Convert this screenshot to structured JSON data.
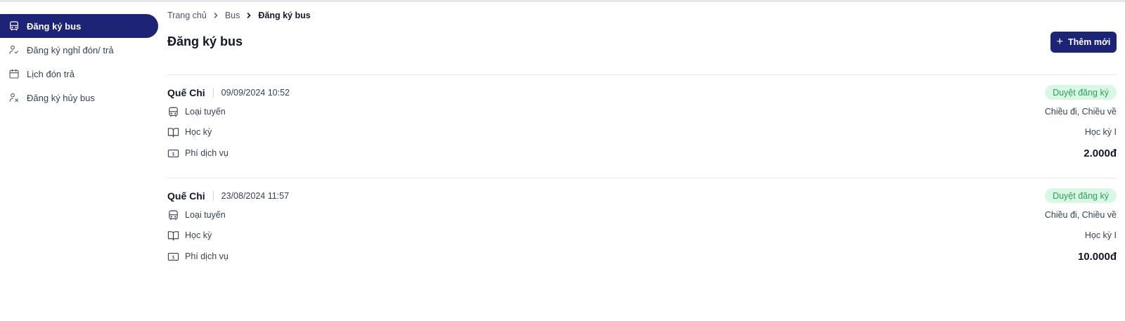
{
  "sidebar": {
    "items": [
      {
        "label": "Đăng ký bus",
        "icon": "bus-icon",
        "active": true
      },
      {
        "label": "Đăng ký nghỉ đón/ trả",
        "icon": "user-check-icon",
        "active": false
      },
      {
        "label": "Lịch đón trả",
        "icon": "calendar-icon",
        "active": false
      },
      {
        "label": "Đăng ký hủy bus",
        "icon": "user-x-icon",
        "active": false
      }
    ]
  },
  "breadcrumb": [
    "Trang chủ",
    "Bus",
    "Đăng ký bus"
  ],
  "page": {
    "title": "Đăng ký bus",
    "add_button": "Thêm mới"
  },
  "labels": {
    "route_type": "Loại tuyến",
    "semester": "Học kỳ",
    "service_fee": "Phí dịch vụ"
  },
  "registrations": [
    {
      "name": "Quế Chi",
      "date": "09/09/2024 10:52",
      "status": "Duyệt đăng ký",
      "route_type": "Chiều đi, Chiều về",
      "semester": "Học kỳ I",
      "fee": "2.000đ"
    },
    {
      "name": "Quế Chi",
      "date": "23/08/2024 11:57",
      "status": "Duyệt đăng ký",
      "route_type": "Chiều đi, Chiều về",
      "semester": "Học kỳ I",
      "fee": "10.000đ"
    }
  ],
  "colors": {
    "primary": "#1d2375",
    "badge_bg": "#d8f7e4",
    "badge_text": "#2f9e5a"
  }
}
